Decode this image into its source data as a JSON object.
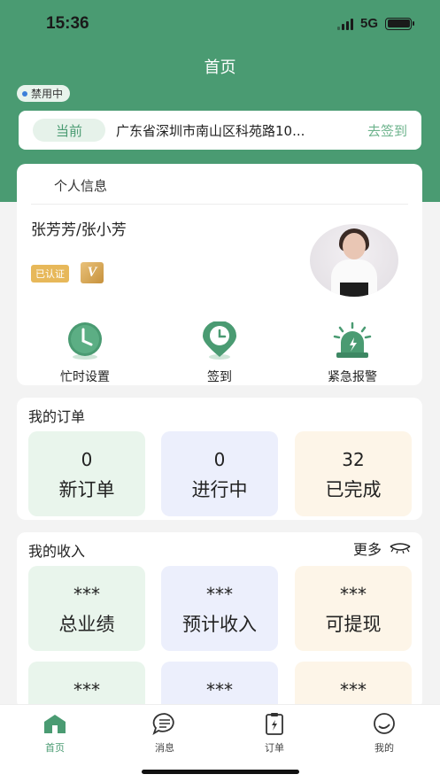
{
  "status_bar": {
    "time": "15:36",
    "network": "5G"
  },
  "header": {
    "title": "首页"
  },
  "badge": {
    "label": "禁用中"
  },
  "location": {
    "current_label": "当前",
    "address": "广东省深圳市南山区科苑路10...",
    "checkin_label": "去签到"
  },
  "profile": {
    "section_title": "个人信息",
    "name": "张芳芳/张小芳",
    "verified_label": "已认证",
    "vip_label": "V",
    "actions": [
      {
        "label": "忙时设置",
        "icon": "clock-icon"
      },
      {
        "label": "签到",
        "icon": "location-clock-icon"
      },
      {
        "label": "紧急报警",
        "icon": "alarm-icon"
      }
    ]
  },
  "orders": {
    "title": "我的订单",
    "tiles": [
      {
        "value": "0",
        "label": "新订单"
      },
      {
        "value": "0",
        "label": "进行中"
      },
      {
        "value": "32",
        "label": "已完成"
      }
    ]
  },
  "income": {
    "title": "我的收入",
    "more_label": "更多",
    "tiles": [
      {
        "value": "***",
        "label": "总业绩"
      },
      {
        "value": "***",
        "label": "预计收入"
      },
      {
        "value": "***",
        "label": "可提现"
      },
      {
        "value": "***",
        "label": ""
      },
      {
        "value": "***",
        "label": ""
      },
      {
        "value": "***",
        "label": ""
      }
    ]
  },
  "tabbar": {
    "items": [
      {
        "label": "首页",
        "icon": "home-icon",
        "active": true
      },
      {
        "label": "消息",
        "icon": "message-icon",
        "active": false
      },
      {
        "label": "订单",
        "icon": "order-icon",
        "active": false
      },
      {
        "label": "我的",
        "icon": "profile-icon",
        "active": false
      }
    ]
  },
  "colors": {
    "primary": "#4a9b72",
    "accent_light": "#e6f2ea",
    "badge_gold": "#e7b85a"
  }
}
